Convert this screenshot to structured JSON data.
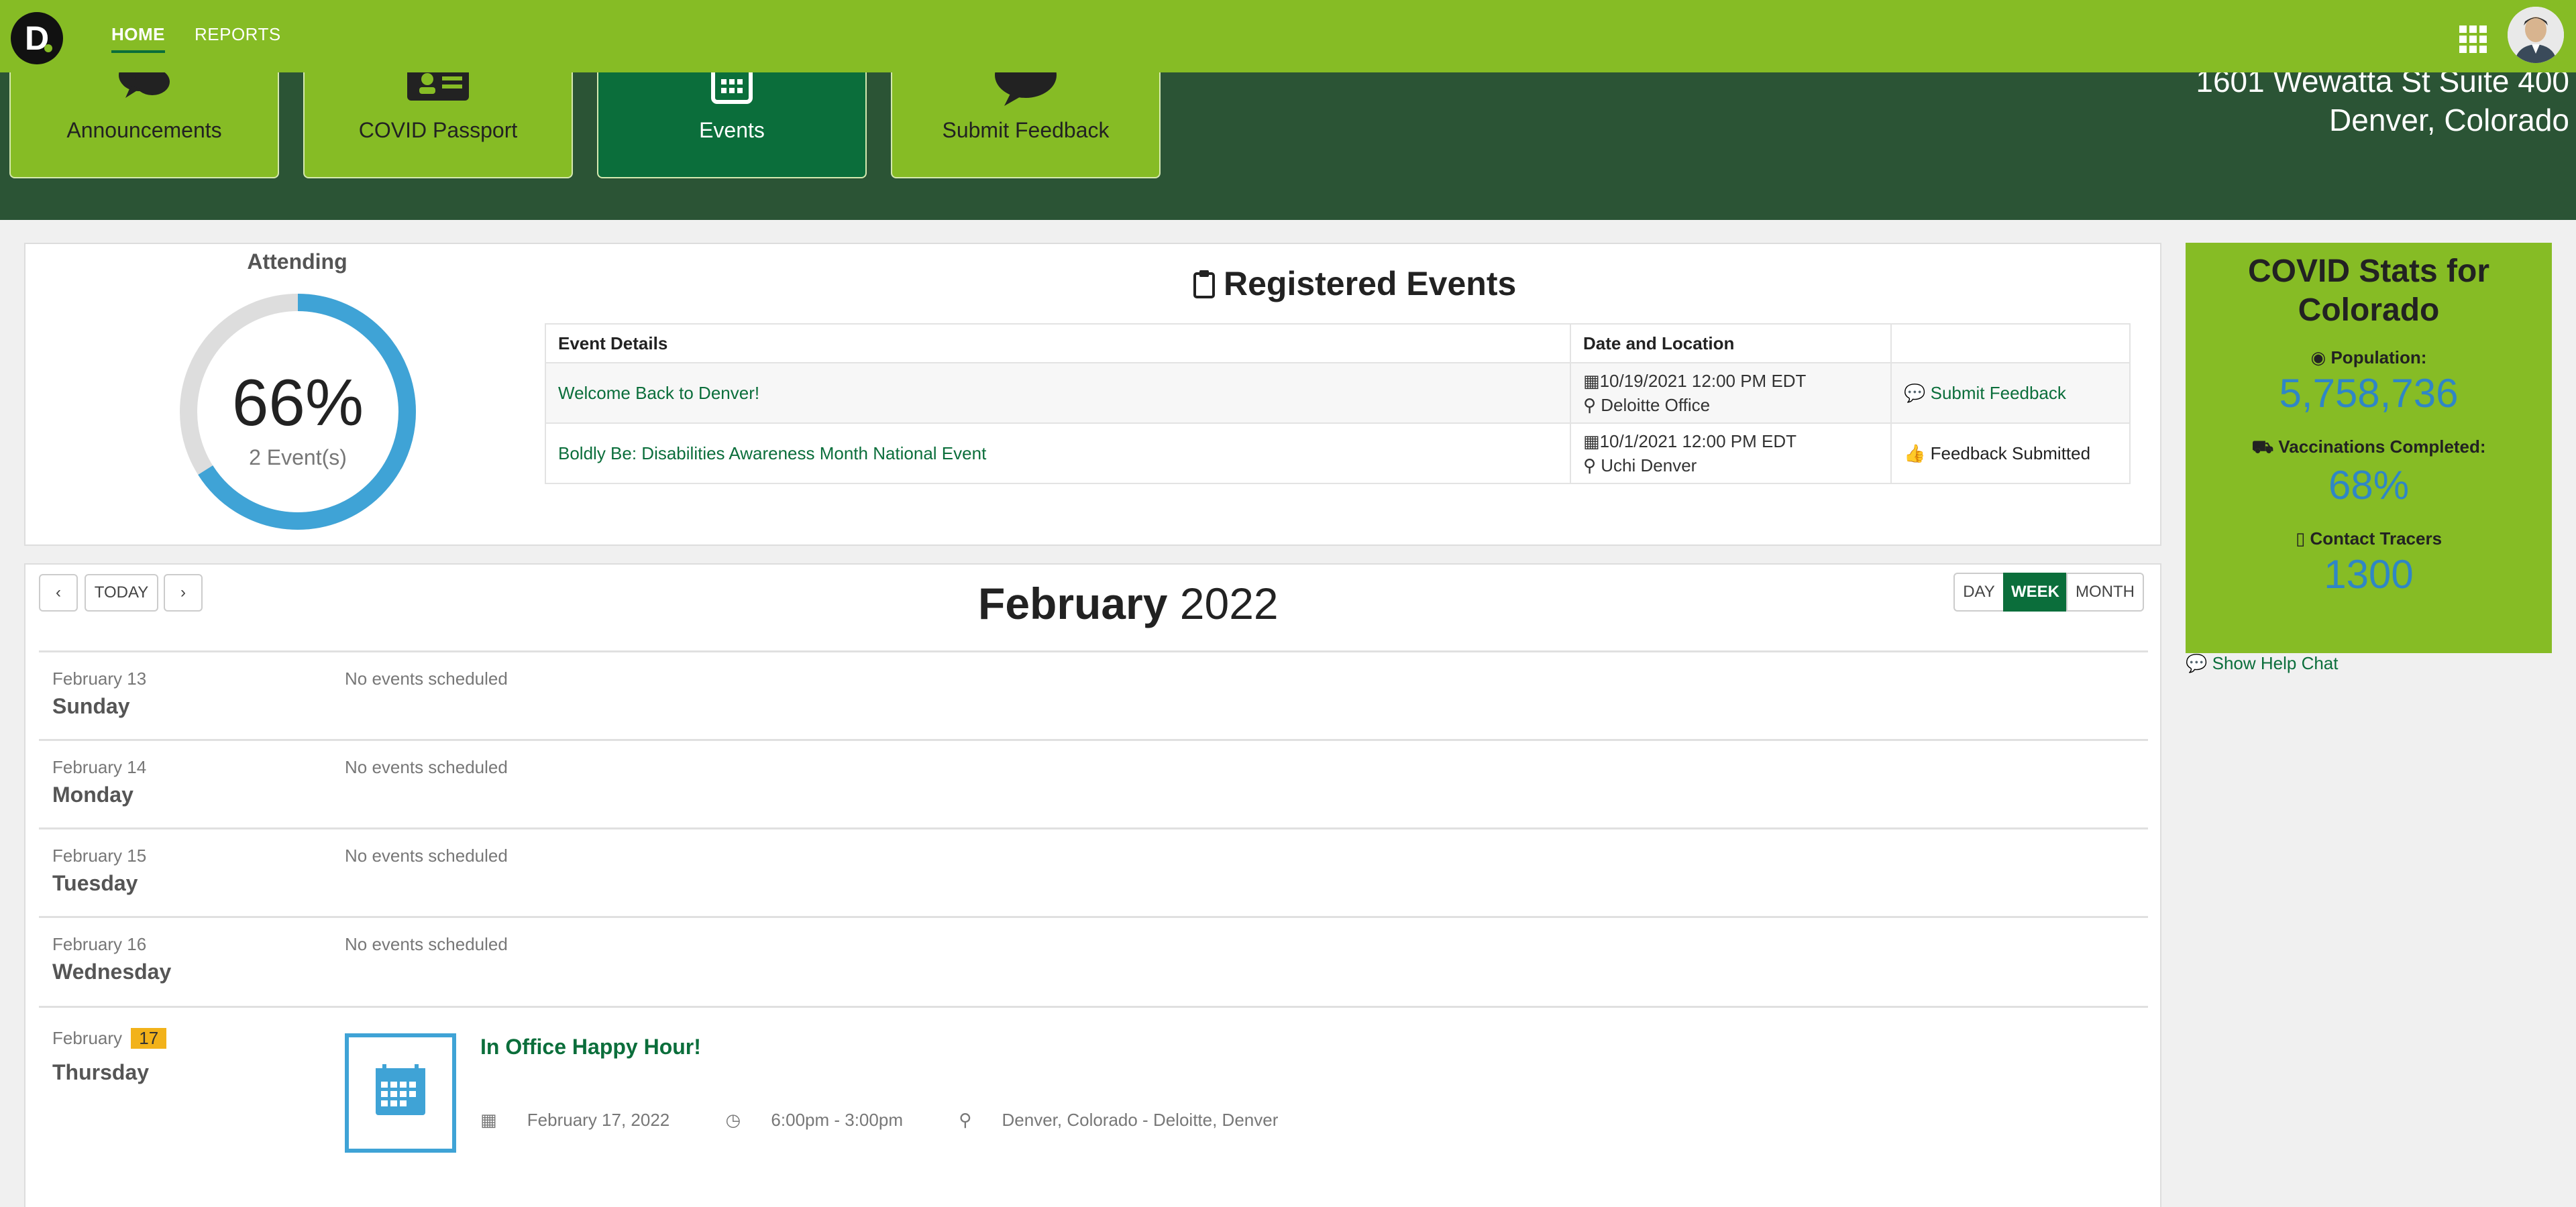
{
  "nav": {
    "logo_letter": "D",
    "links": [
      "HOME",
      "REPORTS"
    ]
  },
  "tiles": [
    {
      "label": "Announcements",
      "icon": "chat-bubbles-icon"
    },
    {
      "label": "COVID Passport",
      "icon": "id-card-icon"
    },
    {
      "label": "Events",
      "icon": "calendar-icon"
    },
    {
      "label": "Submit Feedback",
      "icon": "speech-bubble-icon"
    }
  ],
  "address": {
    "line1": "1601 Wewatta St Suite 400",
    "line2": "Denver, Colorado"
  },
  "attending": {
    "label": "Attending",
    "percent_text": "66%",
    "percent": 66,
    "sub": "2 Event(s)"
  },
  "registered": {
    "title": "Registered Events",
    "headers": [
      "Event Details",
      "Date and Location",
      ""
    ],
    "rows": [
      {
        "name": "Welcome Back to Denver!",
        "date": "10/19/2021 12:00 PM EDT",
        "location": "Deloitte Office",
        "action": "Submit Feedback"
      },
      {
        "name": "Boldly Be: Disabilities Awareness Month National Event",
        "date": "10/1/2021 12:00 PM EDT",
        "location": "Uchi Denver",
        "action": "Feedback Submitted"
      }
    ]
  },
  "calendar": {
    "month": "February",
    "year": "2022",
    "today_label": "TODAY",
    "views": [
      "DAY",
      "WEEK",
      "MONTH"
    ],
    "active_view": "WEEK",
    "days": [
      {
        "date": "February 13",
        "name": "Sunday",
        "empty": "No events scheduled"
      },
      {
        "date": "February 14",
        "name": "Monday",
        "empty": "No events scheduled"
      },
      {
        "date": "February 15",
        "name": "Tuesday",
        "empty": "No events scheduled"
      },
      {
        "date": "February 16",
        "name": "Wednesday",
        "empty": "No events scheduled"
      }
    ],
    "today": {
      "month": "February",
      "day": "17",
      "name": "Thursday",
      "event": {
        "title": "In Office Happy Hour!",
        "date": "February 17, 2022",
        "time": "6:00pm - 3:00pm",
        "location": "Denver, Colorado - Deloitte, Denver"
      }
    }
  },
  "stats": {
    "title": "COVID Stats for Colorado",
    "population_label": "Population:",
    "population": "5,758,736",
    "vacc_label": "Vaccinations Completed:",
    "vacc": "68%",
    "tracers_label": "Contact Tracers",
    "tracers": "1300"
  },
  "help_chat": "Show Help Chat",
  "colors": {
    "brand_green": "#86bc25",
    "dark_green": "#2b5435",
    "accent_green": "#0b6e3b",
    "blue": "#3fa3d6",
    "badge": "#f2b21a"
  }
}
